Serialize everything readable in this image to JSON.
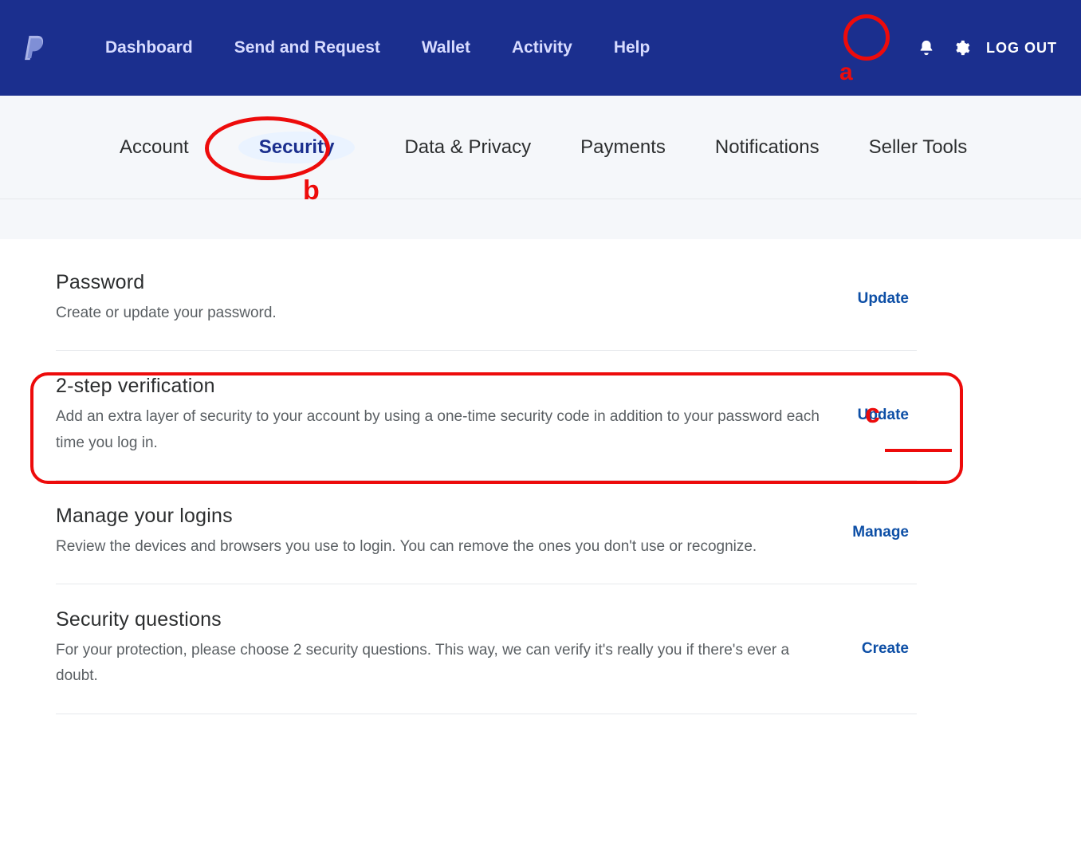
{
  "nav": {
    "items": [
      "Dashboard",
      "Send and Request",
      "Wallet",
      "Activity",
      "Help"
    ],
    "logout": "LOG OUT"
  },
  "tabs": {
    "items": [
      "Account",
      "Security",
      "Data & Privacy",
      "Payments",
      "Notifications",
      "Seller Tools"
    ],
    "active_index": 1
  },
  "sections": [
    {
      "title": "Password",
      "desc": "Create or update your password.",
      "action": "Update"
    },
    {
      "title": "2-step verification",
      "desc": "Add an extra layer of security to your account by using a one-time security code in addition to your password each time you log in.",
      "action": "Update"
    },
    {
      "title": "Manage your logins",
      "desc": "Review the devices and browsers you use to login. You can remove the ones you don't use or recognize.",
      "action": "Manage"
    },
    {
      "title": "Security questions",
      "desc": "For your protection, please choose 2 security questions. This way, we can verify it's really you if there's ever a doubt.",
      "action": "Create"
    }
  ],
  "annotations": {
    "a": "a",
    "b": "b",
    "c": "c"
  }
}
